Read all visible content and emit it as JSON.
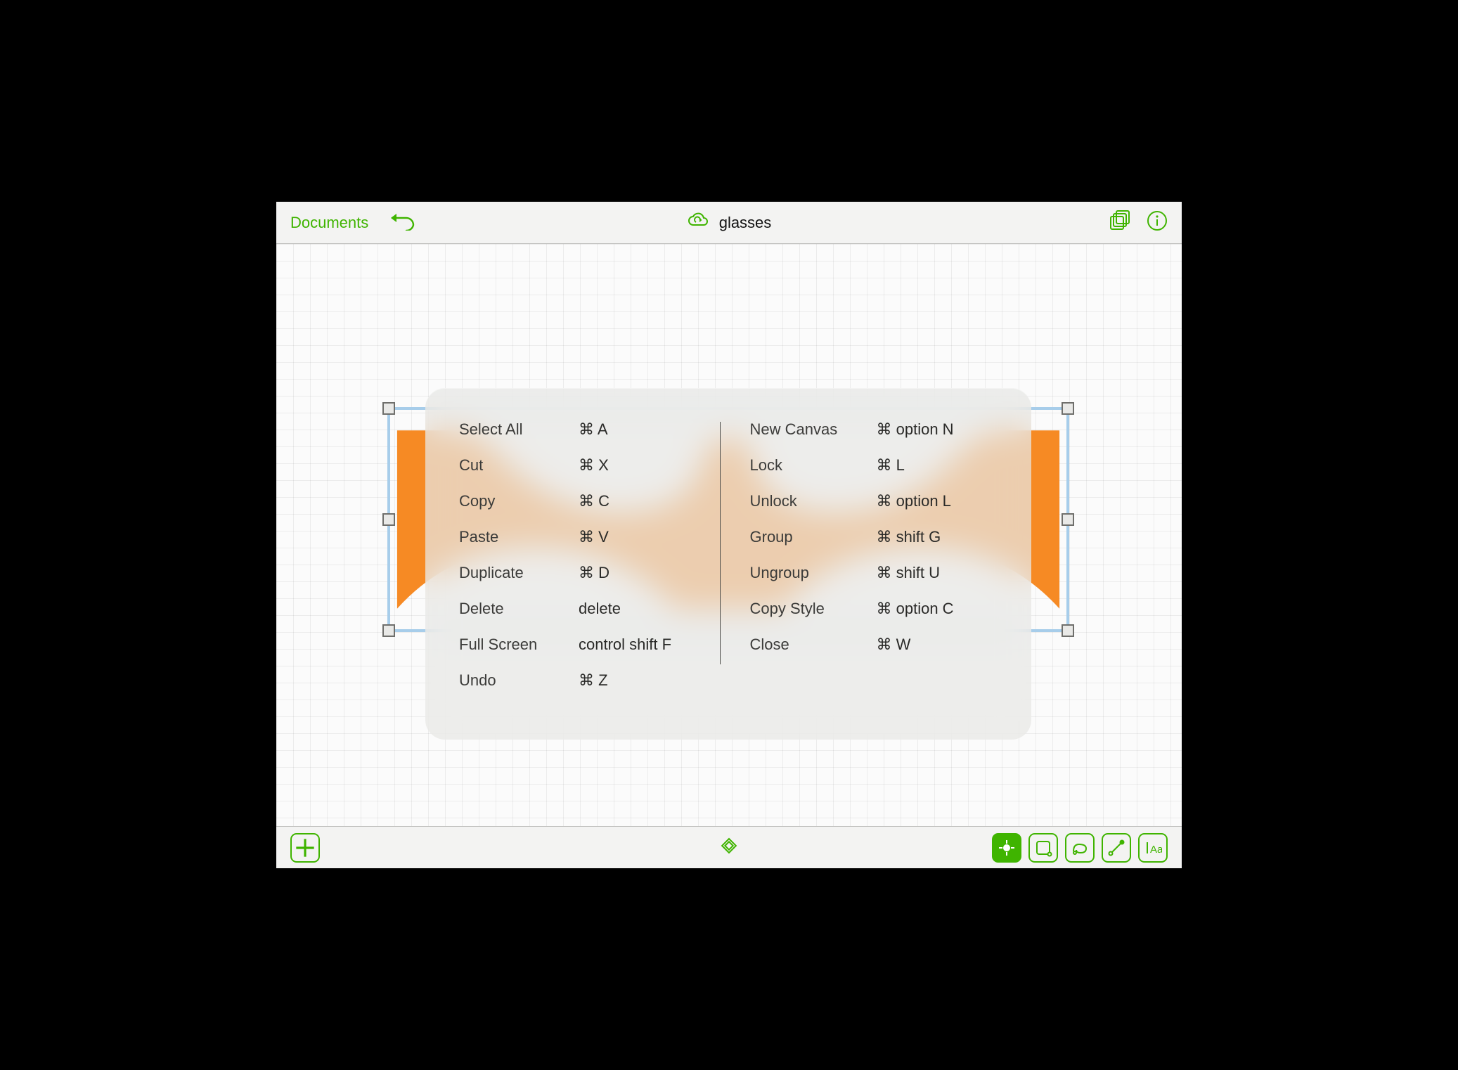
{
  "header": {
    "documents_label": "Documents",
    "title": "glasses"
  },
  "shortcuts": {
    "left": [
      {
        "label": "Select All",
        "keys": "⌘  A"
      },
      {
        "label": "Cut",
        "keys": "⌘  X"
      },
      {
        "label": "Copy",
        "keys": "⌘  C"
      },
      {
        "label": "Paste",
        "keys": "⌘  V"
      },
      {
        "label": "Duplicate",
        "keys": "⌘  D"
      },
      {
        "label": "Delete",
        "keys": "delete"
      },
      {
        "label": "Full Screen",
        "keys": "control shift F"
      },
      {
        "label": "Undo",
        "keys": "⌘  Z"
      }
    ],
    "right": [
      {
        "label": "New Canvas",
        "keys": "⌘  option N"
      },
      {
        "label": "Lock",
        "keys": "⌘  L"
      },
      {
        "label": "Unlock",
        "keys": "⌘  option L"
      },
      {
        "label": "Group",
        "keys": "⌘  shift G"
      },
      {
        "label": "Ungroup",
        "keys": "⌘  shift U"
      },
      {
        "label": "Copy Style",
        "keys": "⌘  option C"
      },
      {
        "label": "Close",
        "keys": "⌘  W"
      }
    ]
  },
  "colors": {
    "accent": "#3fb400",
    "shape": "#f68a24"
  }
}
